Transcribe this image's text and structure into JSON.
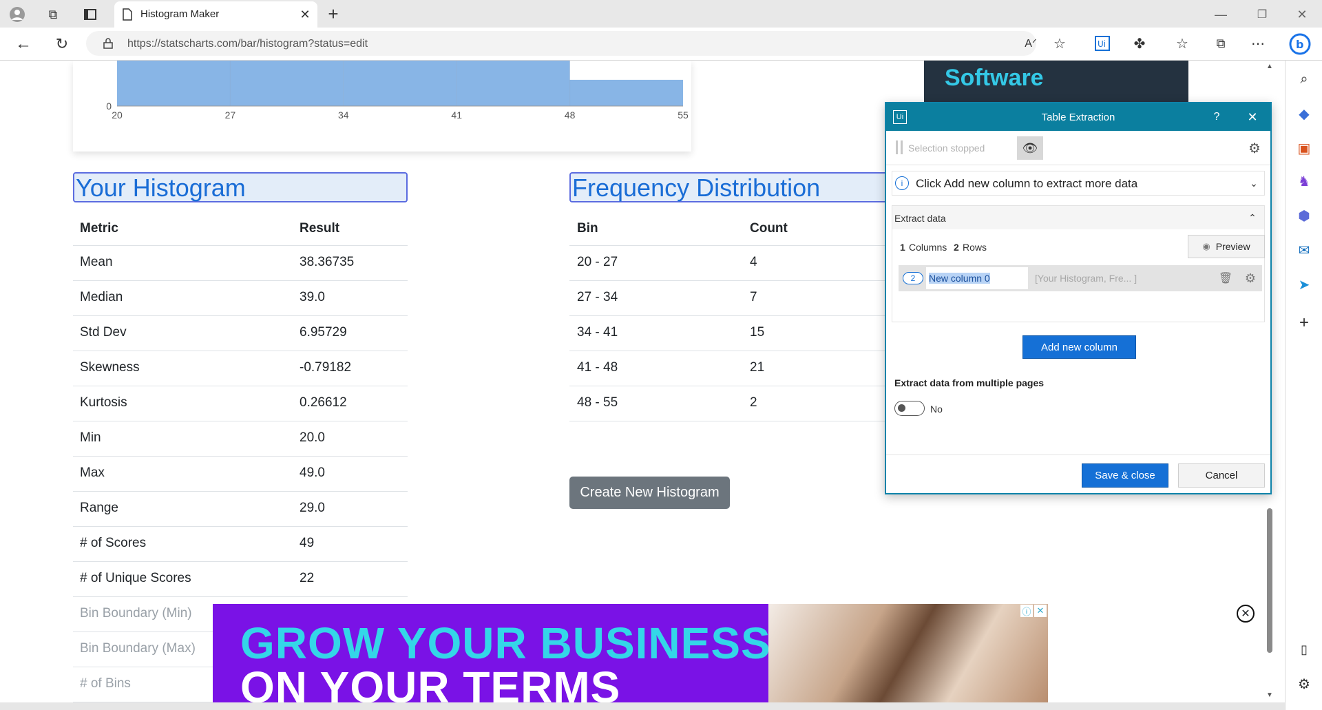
{
  "browser": {
    "tab_title": "Histogram Maker",
    "url": "https://statscharts.com/bar/histogram?status=edit"
  },
  "chart_data": {
    "type": "bar",
    "x_ticks": [
      "20",
      "27",
      "34",
      "41",
      "48",
      "55"
    ],
    "y_ticks": [
      "0"
    ],
    "categories": [
      "20 - 27",
      "27 - 34",
      "34 - 41",
      "41 - 48",
      "48 - 55"
    ],
    "values": [
      4,
      7,
      15,
      21,
      2
    ],
    "ylim": [
      0,
      21
    ]
  },
  "stats": {
    "title": "Your Histogram",
    "col_metric": "Metric",
    "col_result": "Result",
    "rows": [
      {
        "metric": "Mean",
        "result": "38.36735"
      },
      {
        "metric": "Median",
        "result": "39.0"
      },
      {
        "metric": "Std Dev",
        "result": "6.95729"
      },
      {
        "metric": "Skewness",
        "result": "-0.79182"
      },
      {
        "metric": "Kurtosis",
        "result": "0.26612"
      },
      {
        "metric": "Min",
        "result": "20.0"
      },
      {
        "metric": "Max",
        "result": "49.0"
      },
      {
        "metric": "Range",
        "result": "29.0"
      },
      {
        "metric": "# of Scores",
        "result": "49"
      },
      {
        "metric": "# of Unique Scores",
        "result": "22"
      }
    ],
    "faded_rows": [
      "Bin Boundary (Min)",
      "Bin Boundary (Max)",
      "# of Bins"
    ]
  },
  "freq": {
    "title": "Frequency Distribution",
    "col_bin": "Bin",
    "col_count": "Count",
    "rows": [
      {
        "bin": "20 - 27",
        "count": "4"
      },
      {
        "bin": "27 - 34",
        "count": "7"
      },
      {
        "bin": "34 - 41",
        "count": "15"
      },
      {
        "bin": "41 - 48",
        "count": "21"
      },
      {
        "bin": "48 - 55",
        "count": "2"
      }
    ]
  },
  "create_button": "Create New Histogram",
  "ads": {
    "side_text": "Software",
    "banner_line1": "GROW YOUR BUSINESS",
    "banner_line2": "ON YOUR TERMS"
  },
  "dialog": {
    "title": "Table Extraction",
    "help": "?",
    "selection_status": "Selection stopped",
    "info": "Click Add new column to extract more data",
    "extract_header": "Extract data",
    "columns_count": "1",
    "columns_label": "Columns",
    "rows_count": "2",
    "rows_label": "Rows",
    "preview_label": "Preview",
    "column_index": "2",
    "column_name": "New column 0",
    "column_sample": "[Your Histogram, Fre... ]",
    "add_column": "Add new column",
    "multi_page_label": "Extract data from multiple pages",
    "toggle_value": "No",
    "save_close": "Save & close",
    "cancel": "Cancel",
    "logo": "Ui"
  },
  "colors": {
    "accent": "#0b7f9f",
    "bar": "#88b5e6",
    "link": "#1a6dd6"
  }
}
